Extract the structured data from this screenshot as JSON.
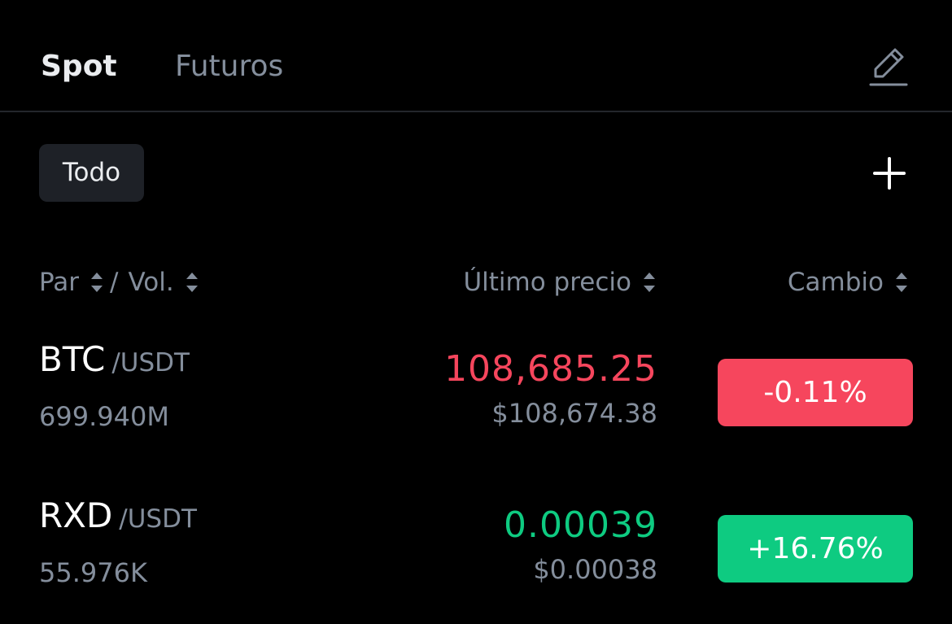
{
  "tabs": [
    {
      "label": "Spot",
      "active": true
    },
    {
      "label": "Futuros",
      "active": false
    }
  ],
  "filter": {
    "label": "Todo"
  },
  "icons": {
    "edit": "pencil-edit-icon",
    "add": "plus-icon",
    "sort": "sort-arrows-icon"
  },
  "colors": {
    "background": "#000000",
    "down": "#f6465d",
    "up": "#0ecb81",
    "muted": "#848e9c",
    "chip": "#1e2127"
  },
  "headers": {
    "pair": "Par",
    "separator": "/",
    "volume": "Vol.",
    "last_price": "Último precio",
    "change": "Cambio"
  },
  "rows": [
    {
      "base": "BTC",
      "quote": "/USDT",
      "volume": "699.940M",
      "price": "108,685.25",
      "fiat_price": "$108,674.38",
      "change": "-0.11%",
      "direction": "down"
    },
    {
      "base": "RXD",
      "quote": "/USDT",
      "volume": "55.976K",
      "price": "0.00039",
      "fiat_price": "$0.00038",
      "change": "+16.76%",
      "direction": "up"
    }
  ]
}
